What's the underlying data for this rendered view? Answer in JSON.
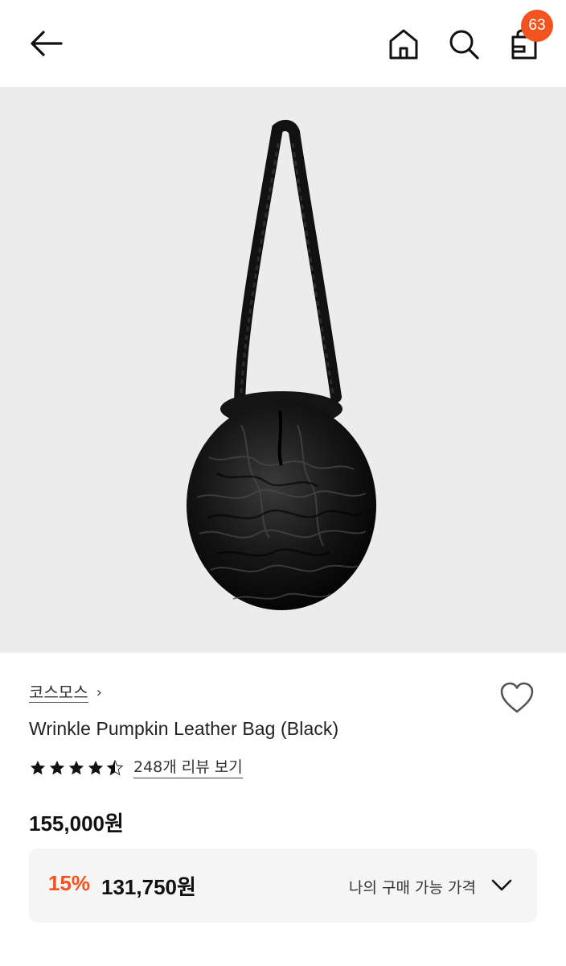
{
  "header": {
    "back_icon": "arrow-left-icon",
    "home_icon": "home-icon",
    "search_icon": "search-icon",
    "cart_icon": "shopping-bag-icon",
    "cart_count": "63"
  },
  "product": {
    "brand": "코스모스",
    "title": "Wrinkle Pumpkin Leather Bag (Black)",
    "rating": 4.5,
    "review_link": "248개 리뷰 보기",
    "original_price": "155,000원",
    "discount_rate": "15%",
    "sale_price": "131,750원",
    "my_price_label": "나의 구매 가능 가격"
  },
  "colors": {
    "accent": "#f2531f",
    "hero_background": "#ececec",
    "price_box_background": "#f5f5f5"
  }
}
